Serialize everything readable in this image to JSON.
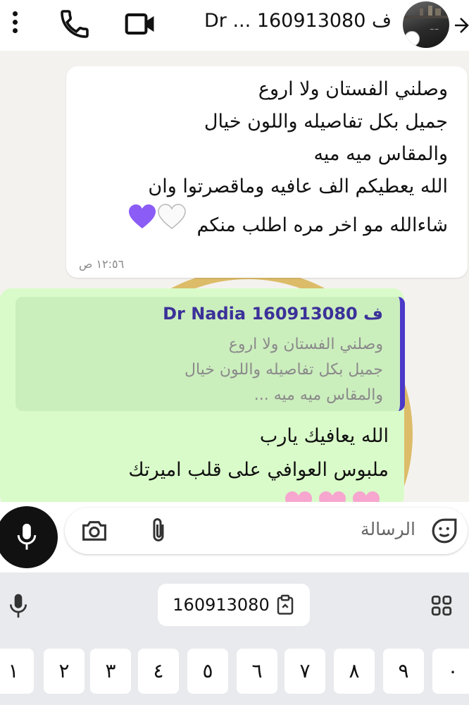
{
  "header": {
    "title": "ف 160913080 ... Dr",
    "icons": [
      "more-vert-icon",
      "call-icon",
      "video-call-icon",
      "avatar",
      "back-arrow-icon"
    ]
  },
  "incoming": {
    "lines": [
      "وصلني الفستان ولا اروع",
      "جميل بكل تفاصيله واللون خيال",
      "والمقاس ميه ميه",
      "الله يعطيكم الف عافيه وماقصرتوا وان",
      "شاءالله مو اخر مره اطلب منكم"
    ],
    "hearts": [
      "purple-heart",
      "white-heart"
    ],
    "time": "١٢:٥٦ ص"
  },
  "outgoing": {
    "quote_name": "ف Dr Nadia 160913080",
    "quote_lines": [
      "وصلني الفستان ولا اروع",
      "جميل بكل تفاصيله واللون خيال",
      "والمقاس ميه ميه ..."
    ],
    "reply_lines": [
      "الله يعافيك يارب",
      "ملبوس العوافي على قلب اميرتك"
    ]
  },
  "composer": {
    "placeholder": "الرسالة"
  },
  "keyboard": {
    "clipboard": "160913080",
    "digits": [
      "١",
      "٢",
      "٣",
      "٤",
      "٥",
      "٦",
      "٧",
      "٨",
      "٩",
      "٠"
    ]
  },
  "colors": {
    "outgoing_bubble": "#d9fbc9",
    "quote_bar": "#4b39c9",
    "quote_name": "#3b3199"
  }
}
